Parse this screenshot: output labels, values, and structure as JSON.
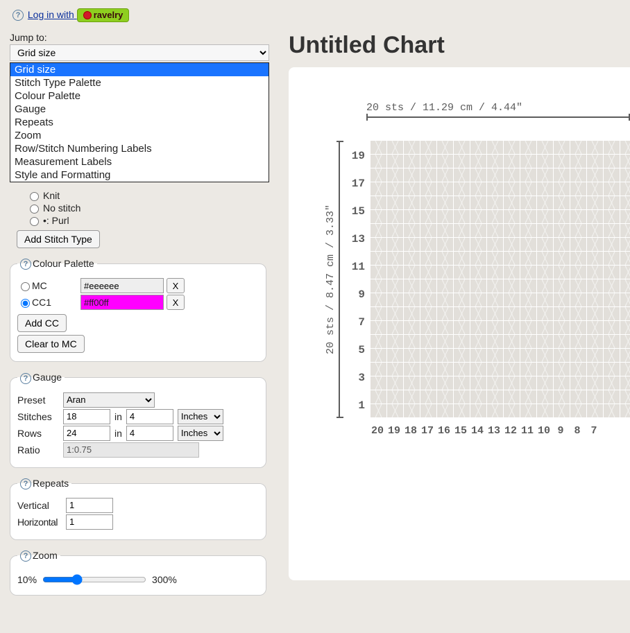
{
  "topbar": {
    "login_prefix": "Log in with",
    "ravelry_label": "ravelry"
  },
  "jump": {
    "label": "Jump to:",
    "selected": "Grid size",
    "options": [
      "Grid size",
      "Stitch Type Palette",
      "Colour Palette",
      "Gauge",
      "Repeats",
      "Zoom",
      "Row/Stitch Numbering Labels",
      "Measurement Labels",
      "Style and Formatting"
    ]
  },
  "stitch": {
    "knit": "Knit",
    "nostitch": "No stitch",
    "purl": "•: Purl",
    "add_btn": "Add Stitch Type"
  },
  "colour": {
    "legend": "Colour Palette",
    "mc_label": "MC",
    "mc_value": "#eeeeee",
    "cc1_label": "CC1",
    "cc1_value": "#ff00ff",
    "x": "X",
    "add_cc": "Add CC",
    "clear": "Clear to MC"
  },
  "gauge": {
    "legend": "Gauge",
    "preset_lbl": "Preset",
    "preset_val": "Aran",
    "stitches_lbl": "Stitches",
    "stitches_val": "18",
    "rows_lbl": "Rows",
    "rows_val": "24",
    "in_lbl": "in",
    "over_val": "4",
    "unit_val": "Inches",
    "ratio_lbl": "Ratio",
    "ratio_val": "1:0.75"
  },
  "repeats": {
    "legend": "Repeats",
    "vert_lbl": "Vertical",
    "vert_val": "1",
    "horiz_lbl": "Horizontal",
    "horiz_val": "1"
  },
  "zoom": {
    "legend": "Zoom",
    "min": "10%",
    "max": "300%"
  },
  "chart": {
    "title": "Untitled Chart",
    "top_ruler": "20 sts / 11.29 cm / 4.44\"",
    "left_ruler": "20 sts / 8.47 cm / 3.33\"",
    "row_labels": [
      "19",
      "17",
      "15",
      "13",
      "11",
      "9",
      "7",
      "5",
      "3",
      "1"
    ],
    "col_labels": [
      "20",
      "19",
      "18",
      "17",
      "16",
      "15",
      "14",
      "13",
      "12",
      "11",
      "10",
      "9",
      "8",
      "7"
    ]
  }
}
